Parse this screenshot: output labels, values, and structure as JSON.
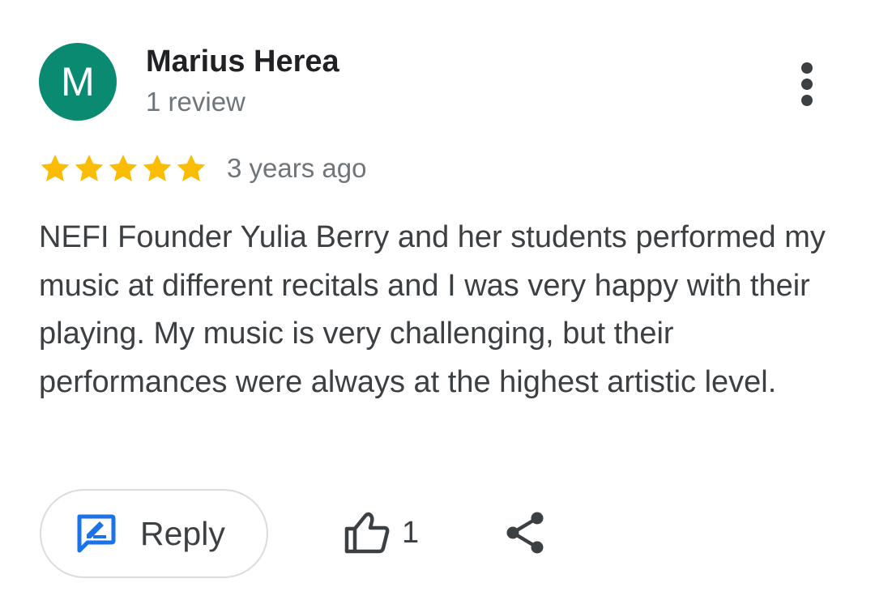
{
  "review": {
    "reviewer": {
      "initial": "M",
      "name": "Marius Herea",
      "review_count": "1 review",
      "avatar_color": "#0b8a72"
    },
    "rating": {
      "stars": 5,
      "max_stars": 5,
      "star_color": "#fbbc04"
    },
    "date": "3 years ago",
    "text": "NEFI Founder Yulia Berry and her students performed my music at different recitals and I was very happy with their playing. My music is very challenging, but their performances were always at the highest artistic level.",
    "actions": {
      "reply_label": "Reply",
      "reply_icon": "rate-review-icon",
      "like_icon": "thumb-up-outline-icon",
      "like_count": "1",
      "share_icon": "share-icon",
      "more_icon": "more-vert-icon",
      "accent_color": "#1a73e8"
    }
  }
}
